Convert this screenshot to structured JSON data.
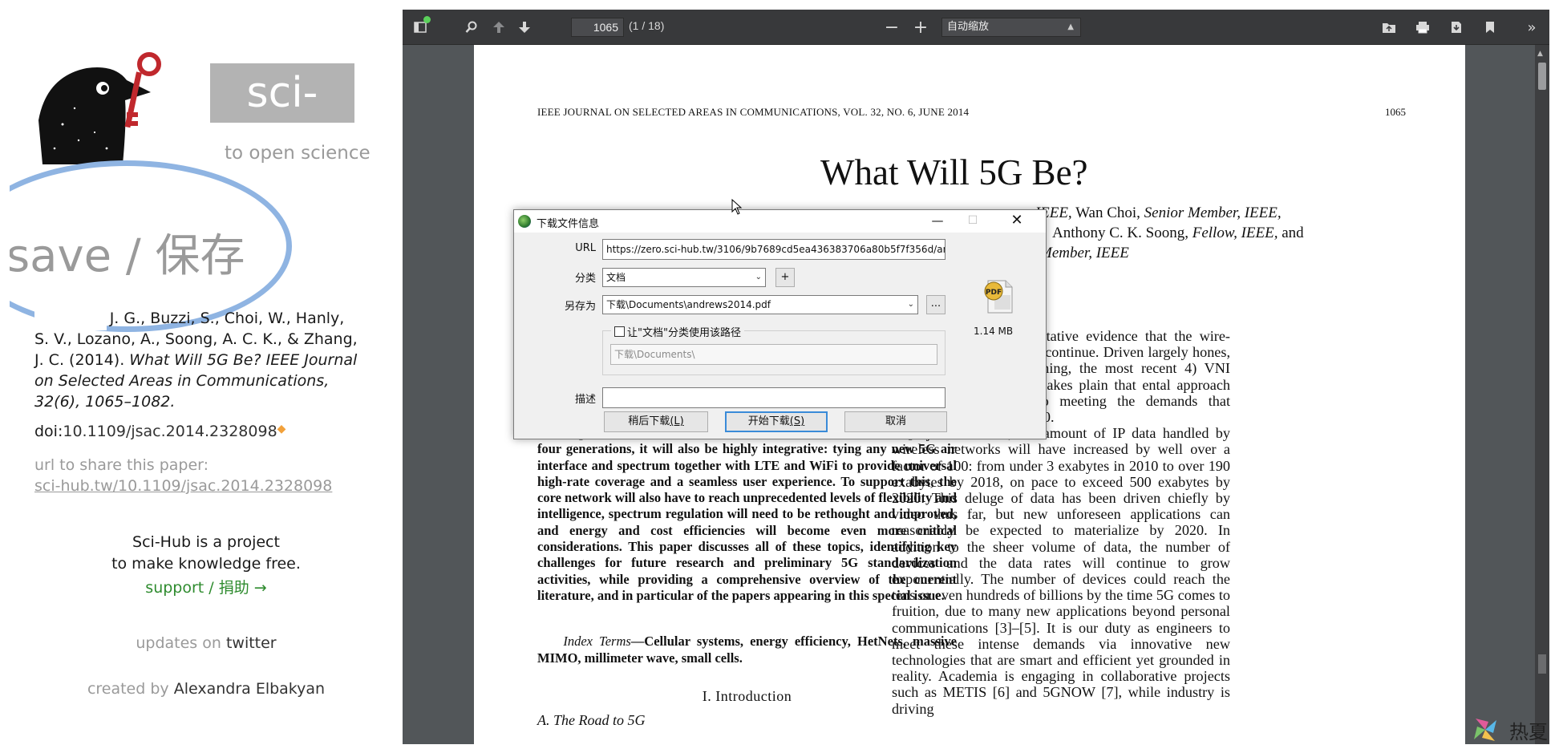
{
  "scihub": {
    "logo_text": "sci-hub",
    "tagline": "to open science",
    "save_text": "save / 保存",
    "citation_line1": "Andrews, J. G., Buzzi, S., Choi, W., Hanly,",
    "citation_line2": "S. V., Lozano, A., Soong, A. C. K., & Zhang,",
    "citation_line3_prefix": "J. C. (2014). ",
    "citation_title": "What Will 5G Be? IEEE Journal on Selected Areas in Communications, 32(6), 1065–1082.",
    "doi_label": "doi:",
    "doi_value": "10.1109/jsac.2014.2328098",
    "share_label": "url to share this paper:",
    "share_url": "sci-hub.tw/10.1109/jsac.2014.2328098",
    "about_line1": "Sci-Hub is a project",
    "about_line2": "to make knowledge free.",
    "support_link": "support / 捐助 →",
    "updates_prefix": "updates on ",
    "updates_link": "twitter",
    "created_prefix": "created by ",
    "created_name": "Alexandra Elbakyan"
  },
  "viewer": {
    "page_number": "1065",
    "page_count": "(1 / 18)",
    "zoom": "自动缩放",
    "icons": [
      "sidebar-toggle-icon",
      "search-icon",
      "previous-page-icon",
      "next-page-icon",
      "zoom-out-icon",
      "zoom-in-icon",
      "open-file-icon",
      "print-icon",
      "download-icon",
      "bookmark-icon",
      "tools-icon"
    ]
  },
  "pdf": {
    "header": "IEEE JOURNAL ON SELECTED AREAS IN COMMUNICATIONS, VOL. 32, NO. 6, JUNE 2014",
    "page_num": "1065",
    "title": "What Will 5G Be?",
    "authors_line1_a": "r, IEEE,",
    "authors_line1_b": " Wan Choi, ",
    "authors_line1_c": "Senior Member, IEEE,",
    "authors_line2_a": "Anthony C. K. Soong, ",
    "authors_line2_b": "Fellow, IEEE,",
    "authors_line2_c": " and",
    "authors_line3": "Member, IEEE",
    "abstract": "and unprecedented numbers of antennas. However, unlike the previous four generations, it will also be highly integrative: tying any new 5G air interface and spectrum together with LTE and WiFi to provide universal high-rate coverage and a seamless user experience. To support this, the core network will also have to reach unprecedented levels of flexibility and intelligence, spectrum regulation will need to be rethought and improved, and energy and cost efficiencies will become even more critical considerations. This paper discusses all of these topics, identifying key challenges for future research and preliminary 5G standardization activities, while providing a comprehensive overview of the current literature, and in particular of the papers appearing in this special issue.",
    "index_terms_label": "Index Terms",
    "index_terms": "—Cellular systems, energy efficiency, HetNets, massive MIMO, millimeter wave, small cells.",
    "section": "I. Introduction",
    "subsection": "A. The Road to 5G",
    "right_p1": "y Cisco, we have quantitative evidence that the wire- explosion is real and will continue. Driven largely hones, tablets, and video streaming, the most recent 4) VNI report [2] and forecast makes plain that ental approach will not come close to meeting the demands that networks will face by 2020.",
    "right_p2": "In just a decade, the amount of IP data handled by wireless networks will have increased by well over a factor of 100: from under 3 exabytes in 2010 to over 190 exabytes by 2018, on pace to exceed 500 exabytes by 2020. This deluge of data has been driven chiefly by video thus far, but new unforeseen applications can reasonably be expected to materialize by 2020. In addition to the sheer volume of data, the number of devices and the data rates will continue to grow exponentially. The number of devices could reach the tens or even hundreds of billions by the time 5G comes to fruition, due to many new applications beyond personal communications [3]–[5]. It is our duty as engineers to meet these intense demands via innovative new technologies that are smart and efficient yet grounded in reality. Academia is engaging in collaborative projects such as METIS [6] and 5GNOW [7], while industry is driving"
  },
  "dialog": {
    "title": "下载文件信息",
    "url_label": "URL",
    "url_value": "https://zero.sci-hub.tw/3106/9b7689cd5ea436383706a80b5f7f356d/andrews2014.pdf",
    "category_label": "分类",
    "category_value": "文档",
    "add_button": "+",
    "saveas_label": "另存为",
    "saveas_value": "下载\\Documents\\andrews2014.pdf",
    "browse_button": "...",
    "checkbox_label": "让\"文档\"分类使用该路径",
    "path_value": "下载\\Documents\\",
    "desc_label": "描述",
    "file_size": "1.14  MB",
    "later_button": "稍后下载",
    "later_key": "(L)",
    "start_button": "开始下载",
    "start_key": "(S)",
    "cancel_button": "取消"
  },
  "watermark": "热夏"
}
